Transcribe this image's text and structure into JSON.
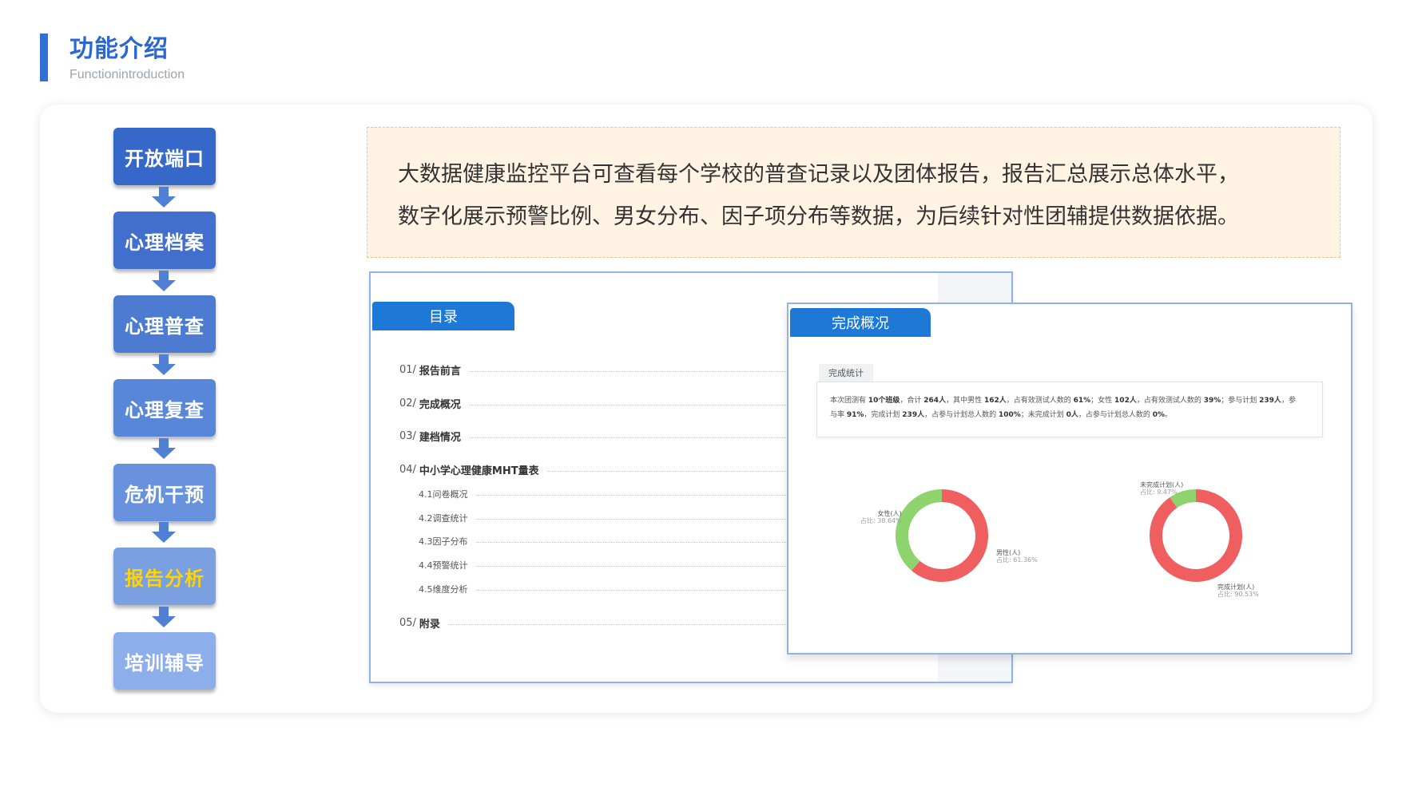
{
  "header": {
    "title": "功能介绍",
    "subtitle": "Functionintroduction"
  },
  "flow": {
    "steps": [
      {
        "label": "开放端口",
        "color": "#3568c9"
      },
      {
        "label": "心理档案",
        "color": "#426fcd"
      },
      {
        "label": "心理普查",
        "color": "#4d7bd2"
      },
      {
        "label": "心理复查",
        "color": "#5886d8"
      },
      {
        "label": "危机干预",
        "color": "#6892dd"
      },
      {
        "label": "报告分析",
        "color": "#7aa0e2",
        "active": true
      },
      {
        "label": "培训辅导",
        "color": "#8caeea"
      }
    ],
    "arrow_color": "#4f80d6",
    "active_text_color": "#ffd400"
  },
  "description": {
    "line1": "大数据健康监控平台可查看每个学校的普查记录以及团体报告，报告汇总展示总体水平，",
    "line2": "数字化展示预警比例、男女分布、因子项分布等数据，为后续针对性团辅提供数据依据。"
  },
  "toc": {
    "header": "目录",
    "items": [
      {
        "num": "01/",
        "label": "报告前言"
      },
      {
        "num": "02/",
        "label": "完成概况"
      },
      {
        "num": "03/",
        "label": "建档情况"
      },
      {
        "num": "04/",
        "label": "中小学心理健康MHT量表"
      },
      {
        "num": "",
        "label": "4.1问卷概况"
      },
      {
        "num": "",
        "label": "4.2调查统计"
      },
      {
        "num": "",
        "label": "4.3因子分布"
      },
      {
        "num": "",
        "label": "4.4预警统计"
      },
      {
        "num": "",
        "label": "4.5维度分析"
      },
      {
        "num": "05/",
        "label": "附录"
      }
    ]
  },
  "completion": {
    "header": "完成概况",
    "stat_tab": "完成统计",
    "stat_line1": {
      "p1": "本次团测有 ",
      "b1": "10个班级",
      "p2": "，合计 ",
      "b2": "264人",
      "p3": "，其中男性 ",
      "b3": "162人",
      "p4": "，占有效测试人数的 ",
      "b4": "61%",
      "p5": "；女性 ",
      "b5": "102人",
      "p6": "，占有效测试人数的 ",
      "b6": "39%",
      "p7": "；参与计划 ",
      "b7": "239人",
      "p8": "，参"
    },
    "stat_line2": {
      "p1": "与率 ",
      "b1": "91%",
      "p2": "，完成计划 ",
      "b2": "239人",
      "p3": "，占参与计划总人数的 ",
      "b3": "100%",
      "p4": "；未完成计划 ",
      "b4": "0人",
      "p5": "，占参与计划总人数的 ",
      "b5": "0%",
      "p6": "。"
    },
    "gender_donut": {
      "slices": [
        {
          "name": "男性(人)",
          "pct_label": "占比: 61.36%",
          "value": 61.36,
          "color": "#ef5f5f"
        },
        {
          "name": "女性(人)",
          "pct_label": "占比: 38.64%",
          "value": 38.64,
          "color": "#8fd36f"
        }
      ]
    },
    "plan_donut": {
      "slices": [
        {
          "name": "完成计划(人)",
          "pct_label": "占比: 90.53%",
          "value": 90.53,
          "color": "#ef5f5f"
        },
        {
          "name": "未完成计划(人)",
          "pct_label": "占比: 9.47%",
          "value": 9.47,
          "color": "#8fd36f"
        }
      ]
    }
  }
}
